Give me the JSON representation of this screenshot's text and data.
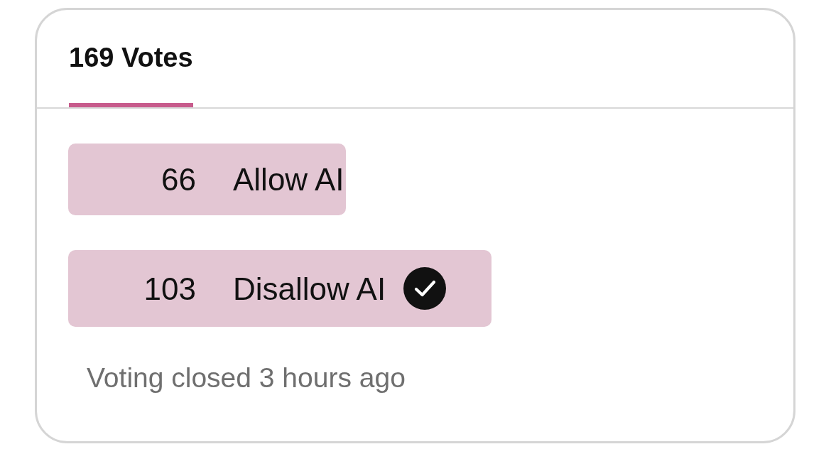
{
  "poll": {
    "tabs": [
      {
        "label": "169 Votes",
        "selected": true
      }
    ],
    "options": [
      {
        "count": "66",
        "label": "Allow AI",
        "level": 0.4,
        "selected": false
      },
      {
        "count": "103",
        "label": "Disallow AI",
        "level": 0.61,
        "selected": true
      }
    ],
    "status": "Voting closed 3 hours ago"
  }
}
